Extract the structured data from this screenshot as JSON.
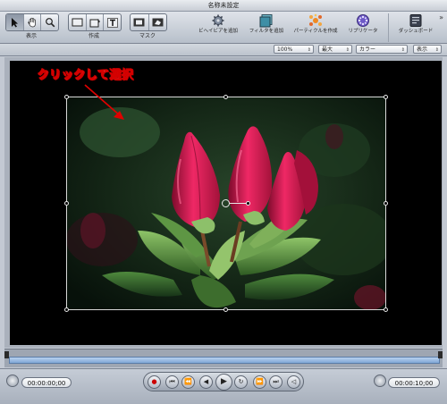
{
  "window": {
    "title": "名称未設定"
  },
  "toolbar": {
    "view_label": "表示",
    "create_label": "作成",
    "mask_label": "マスク",
    "tools": [
      {
        "label": "ビヘイビアを追加",
        "icon": "gear-icon"
      },
      {
        "label": "フィルタを追加",
        "icon": "filter-icon"
      },
      {
        "label": "パーティクルを作成",
        "icon": "particle-icon"
      },
      {
        "label": "リプリケータ",
        "icon": "replicator-icon"
      },
      {
        "label": "ダッシュボード",
        "icon": "dashboard-icon"
      }
    ],
    "more": "»"
  },
  "options": {
    "zoom": "100%",
    "quality": "最大",
    "channel": "カラー",
    "view": "表示"
  },
  "canvas": {
    "annotation": "クリックして選択"
  },
  "transport": {
    "current_timecode": "00:00:00;00",
    "duration_timecode": "00:00:10;00"
  }
}
